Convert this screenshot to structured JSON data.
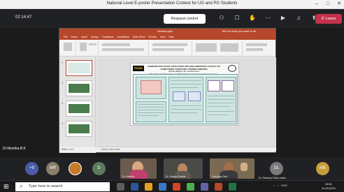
{
  "window": {
    "title": "National Level E-poster Presentation Contest for UG and PG Students",
    "controls": [
      "–",
      "□",
      "✕"
    ]
  },
  "meeting": {
    "timer": "02:14:47",
    "request_control_label": "Request control",
    "toolbar_icons": [
      "people-icon",
      "chat-icon",
      "raise-hand-icon",
      "more-icon",
      "camera-icon",
      "mic-icon",
      "share-icon"
    ],
    "leave_label": "Leave",
    "presenter_name": "Dr.Nivetha.B.K",
    "accent_color": "#c4314b"
  },
  "powerpoint": {
    "titlebar_text": "Nivetha.pptx",
    "search_text": "Tell me what you want to do",
    "menu": [
      "File",
      "Home",
      "Insert",
      "Design",
      "Transitions",
      "Animations",
      "Slide Show",
      "Review",
      "View",
      "Help"
    ],
    "slide_numbers": [
      "1",
      "2",
      "3",
      "4"
    ],
    "status": "Slide 1 of 4",
    "notes_placeholder": "Click to add notes",
    "accent_color": "#b7472a",
    "poster": {
      "logo_text": "PSGR",
      "title_lines": [
        "COMPARATIVE STUDY ON IN-VITRO ANTI-INFLAMMATORY ACTIVITY OF COMPOUNDS TARGETING UTERINE FIBROIDS",
        "Nivetha Balaji & Dr. Nivedha Devi",
        "PG & Research Department of Biotechnology, Women's Christian College, Chennai, Tamil Nadu"
      ]
    }
  },
  "participants": {
    "avatars": [
      {
        "initials": "+9",
        "color": "#4a5ba8"
      },
      {
        "initials": "MR",
        "color": "#8a7d6a"
      },
      {
        "initials": "",
        "color": "#c67b2b"
      },
      {
        "initials": "D",
        "color": "#5b7a5b"
      }
    ],
    "video_tiles": [
      {
        "name": "Dr. Nivetha"
      },
      {
        "name": "Dr. Uthaya Sankar"
      },
      {
        "name": "Sowmiya Devi"
      }
    ],
    "right_avatars": [
      {
        "initials": "DL",
        "color": "#7a7a7a",
        "name": "Dr. Ravinraj Chitra Lakhs"
      },
      {
        "initials": "MB",
        "color": "#c69c3a",
        "name": ""
      }
    ]
  },
  "taskbar": {
    "search_placeholder": "Type here to search",
    "tray_text": "ENG",
    "time": "15:51",
    "date": "11-03-2021"
  }
}
